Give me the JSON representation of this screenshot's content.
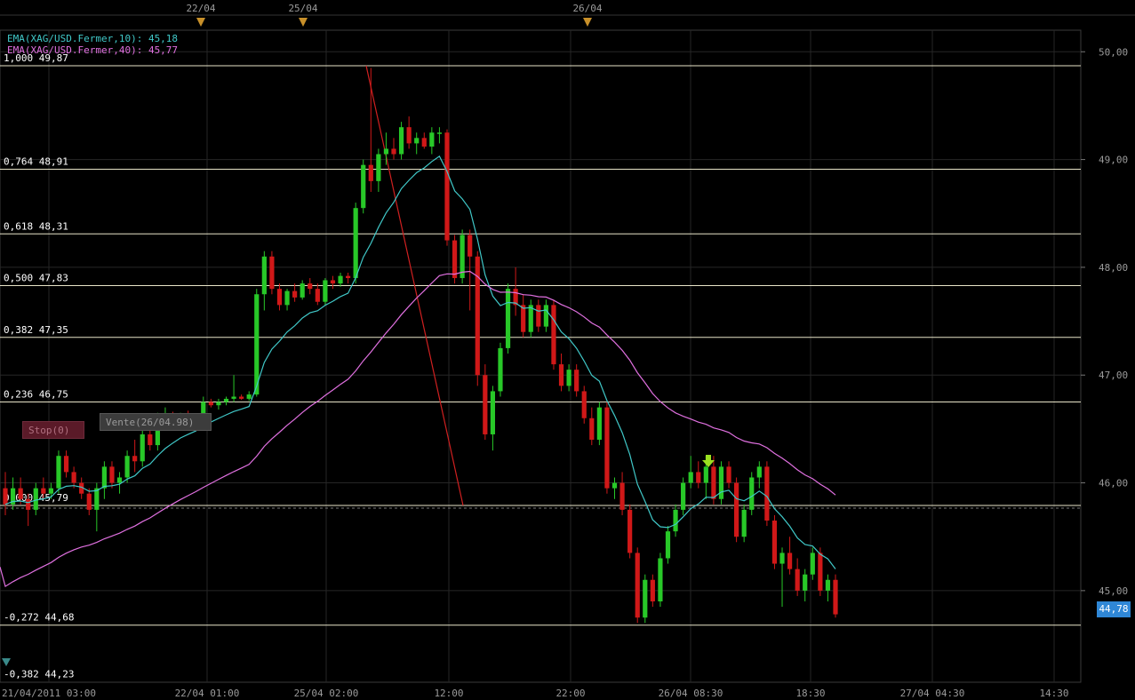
{
  "chart_data": {
    "type": "candlestick",
    "x_ticks": [
      "21/04/2011 03:00",
      "22/04 01:00",
      "25/04 02:00",
      "12:00",
      "22:00",
      "26/04 08:30",
      "18:30",
      "27/04 04:30",
      "14:30"
    ],
    "top_date_markers": [
      "22/04",
      "25/04",
      "26/04"
    ],
    "ylim": [
      44.15,
      50.2
    ],
    "y_ticks": [
      "50,00",
      "49,00",
      "48,00",
      "47,00",
      "46,00",
      "45,00"
    ],
    "y_tick_values": [
      50,
      49,
      48,
      47,
      46,
      45
    ],
    "legend": [
      {
        "text": "EMA(XAG/USD.Fermer,10): 45,18",
        "color": "#40c8c8"
      },
      {
        "text": "EMA(XAG/USD.Fermer,40): 45,77",
        "color": "#e070e0"
      }
    ],
    "fibonacci_levels": [
      {
        "label": "1,000 49,87",
        "value": 49.87
      },
      {
        "label": "0,764 48,91",
        "value": 48.91
      },
      {
        "label": "0,618 48,31",
        "value": 48.31
      },
      {
        "label": "0,500 47,83",
        "value": 47.83
      },
      {
        "label": "0,382 47,35",
        "value": 47.35
      },
      {
        "label": "0,236 46,75",
        "value": 46.75
      },
      {
        "label": "0,000 45,79",
        "value": 45.79
      },
      {
        "label": "-0,272 44,68",
        "value": 44.68
      },
      {
        "label": "-0,382 44,23",
        "value": 44.23
      }
    ],
    "current_price": "44,78",
    "candles": [
      [
        45.95,
        46.1,
        45.7,
        45.8
      ],
      [
        45.8,
        46.05,
        45.75,
        45.95
      ],
      [
        45.95,
        46.05,
        45.8,
        45.85
      ],
      [
        45.85,
        45.9,
        45.6,
        45.75
      ],
      [
        45.75,
        46.0,
        45.7,
        45.95
      ],
      [
        45.95,
        46.05,
        45.85,
        45.9
      ],
      [
        45.9,
        46.0,
        45.85,
        45.95
      ],
      [
        45.95,
        46.3,
        45.9,
        46.25
      ],
      [
        46.25,
        46.3,
        46.05,
        46.1
      ],
      [
        46.1,
        46.15,
        45.95,
        46.0
      ],
      [
        46.0,
        46.05,
        45.85,
        45.9
      ],
      [
        45.9,
        45.95,
        45.7,
        45.75
      ],
      [
        45.75,
        46.0,
        45.55,
        45.95
      ],
      [
        45.95,
        46.2,
        45.85,
        46.15
      ],
      [
        46.15,
        46.2,
        45.95,
        46.0
      ],
      [
        46.0,
        46.1,
        45.9,
        46.05
      ],
      [
        46.05,
        46.3,
        46.0,
        46.25
      ],
      [
        46.25,
        46.4,
        46.1,
        46.2
      ],
      [
        46.2,
        46.5,
        46.15,
        46.45
      ],
      [
        46.45,
        46.5,
        46.3,
        46.35
      ],
      [
        46.35,
        46.65,
        46.3,
        46.6
      ],
      [
        46.6,
        46.7,
        46.55,
        46.62
      ],
      [
        46.62,
        46.66,
        46.58,
        46.6
      ],
      [
        46.6,
        46.65,
        46.57,
        46.63
      ],
      [
        46.63,
        46.67,
        46.58,
        46.6
      ],
      [
        46.6,
        46.64,
        46.58,
        46.62
      ],
      [
        46.62,
        46.8,
        46.6,
        46.75
      ],
      [
        46.75,
        46.78,
        46.7,
        46.72
      ],
      [
        46.72,
        46.78,
        46.68,
        46.75
      ],
      [
        46.75,
        46.8,
        46.72,
        46.78
      ],
      [
        46.78,
        47.0,
        46.75,
        46.8
      ],
      [
        46.8,
        46.82,
        46.77,
        46.78
      ],
      [
        46.78,
        46.85,
        46.76,
        46.82
      ],
      [
        46.82,
        47.8,
        46.8,
        47.75
      ],
      [
        47.75,
        48.15,
        47.6,
        48.1
      ],
      [
        48.1,
        48.15,
        47.75,
        47.8
      ],
      [
        47.8,
        47.85,
        47.6,
        47.65
      ],
      [
        47.65,
        47.8,
        47.6,
        47.78
      ],
      [
        47.78,
        47.85,
        47.68,
        47.72
      ],
      [
        47.72,
        47.88,
        47.7,
        47.85
      ],
      [
        47.85,
        47.9,
        47.75,
        47.8
      ],
      [
        47.8,
        47.85,
        47.65,
        47.68
      ],
      [
        47.68,
        47.9,
        47.65,
        47.88
      ],
      [
        47.88,
        47.92,
        47.8,
        47.85
      ],
      [
        47.85,
        47.95,
        47.82,
        47.92
      ],
      [
        47.92,
        47.95,
        47.85,
        47.9
      ],
      [
        47.9,
        48.6,
        47.85,
        48.55
      ],
      [
        48.55,
        49.0,
        48.5,
        48.95
      ],
      [
        48.95,
        49.85,
        48.7,
        48.8
      ],
      [
        48.8,
        49.1,
        48.7,
        49.05
      ],
      [
        49.05,
        49.25,
        48.95,
        49.1
      ],
      [
        49.1,
        49.2,
        49.0,
        49.05
      ],
      [
        49.05,
        49.35,
        49.0,
        49.3
      ],
      [
        49.3,
        49.4,
        49.1,
        49.15
      ],
      [
        49.15,
        49.25,
        49.05,
        49.2
      ],
      [
        49.2,
        49.25,
        49.1,
        49.12
      ],
      [
        49.12,
        49.3,
        49.05,
        49.25
      ],
      [
        49.25,
        49.3,
        49.15,
        49.25
      ],
      [
        49.25,
        49.28,
        48.2,
        48.25
      ],
      [
        48.25,
        48.3,
        47.85,
        47.9
      ],
      [
        47.9,
        48.35,
        47.85,
        48.3
      ],
      [
        48.3,
        48.35,
        47.6,
        48.1
      ],
      [
        48.1,
        48.15,
        46.9,
        47.0
      ],
      [
        47.0,
        47.1,
        46.4,
        46.45
      ],
      [
        46.45,
        46.9,
        46.3,
        46.85
      ],
      [
        46.85,
        47.3,
        46.8,
        47.25
      ],
      [
        47.25,
        47.85,
        47.2,
        47.8
      ],
      [
        47.8,
        48.0,
        47.55,
        47.65
      ],
      [
        47.65,
        47.75,
        47.35,
        47.4
      ],
      [
        47.4,
        47.7,
        47.35,
        47.65
      ],
      [
        47.65,
        47.7,
        47.4,
        47.45
      ],
      [
        47.45,
        47.7,
        47.4,
        47.65
      ],
      [
        47.65,
        47.7,
        47.05,
        47.1
      ],
      [
        47.1,
        47.2,
        46.85,
        46.9
      ],
      [
        46.9,
        47.1,
        46.85,
        47.05
      ],
      [
        47.05,
        47.1,
        46.8,
        46.85
      ],
      [
        46.85,
        46.9,
        46.55,
        46.6
      ],
      [
        46.6,
        46.7,
        46.35,
        46.4
      ],
      [
        46.4,
        46.75,
        46.35,
        46.7
      ],
      [
        46.7,
        46.75,
        45.9,
        45.95
      ],
      [
        45.95,
        46.05,
        45.85,
        46.0
      ],
      [
        46.0,
        46.1,
        45.7,
        45.75
      ],
      [
        45.75,
        45.8,
        45.3,
        45.35
      ],
      [
        45.35,
        45.4,
        44.7,
        44.75
      ],
      [
        44.75,
        45.15,
        44.7,
        45.1
      ],
      [
        45.1,
        45.15,
        44.85,
        44.9
      ],
      [
        44.9,
        45.35,
        44.85,
        45.3
      ],
      [
        45.3,
        45.6,
        45.25,
        45.55
      ],
      [
        45.55,
        45.8,
        45.5,
        45.75
      ],
      [
        45.75,
        46.05,
        45.7,
        46.0
      ],
      [
        46.0,
        46.25,
        45.95,
        46.1
      ],
      [
        46.1,
        46.2,
        45.95,
        46.0
      ],
      [
        46.0,
        46.25,
        45.85,
        46.15
      ],
      [
        46.15,
        46.25,
        45.8,
        45.85
      ],
      [
        45.85,
        46.2,
        45.8,
        46.15
      ],
      [
        46.15,
        46.2,
        45.95,
        46.0
      ],
      [
        46.0,
        46.05,
        45.45,
        45.5
      ],
      [
        45.5,
        45.8,
        45.45,
        45.75
      ],
      [
        45.75,
        46.1,
        45.7,
        46.05
      ],
      [
        46.05,
        46.2,
        45.95,
        46.15
      ],
      [
        46.15,
        46.2,
        45.6,
        45.65
      ],
      [
        45.65,
        45.7,
        45.2,
        45.25
      ],
      [
        45.25,
        45.4,
        44.85,
        45.35
      ],
      [
        45.35,
        45.5,
        45.15,
        45.2
      ],
      [
        45.2,
        45.3,
        44.95,
        45.0
      ],
      [
        45.0,
        45.2,
        44.9,
        45.15
      ],
      [
        45.15,
        45.4,
        45.1,
        45.35
      ],
      [
        45.35,
        45.4,
        44.95,
        45.0
      ],
      [
        45.0,
        45.15,
        44.9,
        45.1
      ],
      [
        45.1,
        45.15,
        44.75,
        44.78
      ]
    ]
  }
}
